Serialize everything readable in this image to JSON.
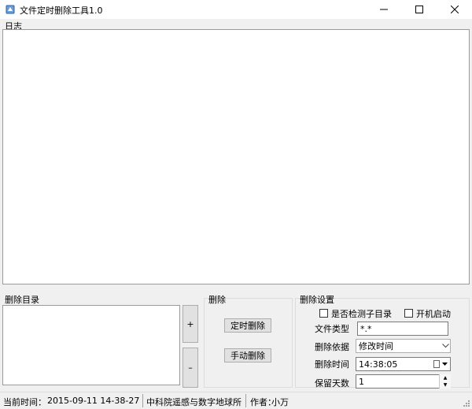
{
  "window": {
    "title": "文件定时删除工具1.0",
    "minimize_symbol": "—",
    "maximize_symbol": "☐",
    "close_symbol": "✕"
  },
  "log": {
    "label": "日志"
  },
  "directory": {
    "label": "删除目录",
    "add_label": "+",
    "remove_label": "–"
  },
  "delete": {
    "label": "删除",
    "timed_button": "定时删除",
    "manual_button": "手动删除"
  },
  "settings": {
    "label": "删除设置",
    "check_subdir_label": "是否检测子目录",
    "check_subdir_checked": false,
    "startup_label": "开机启动",
    "startup_checked": false,
    "file_type_label": "文件类型",
    "file_type_value": "*.*",
    "basis_label": "删除依据",
    "basis_value": "修改时间",
    "time_label": "删除时间",
    "time_value": "14:38:05",
    "days_label": "保留天数",
    "days_value": "1"
  },
  "status": {
    "time_label": "当前时间：",
    "time_value": "2015-09-11 14-38-27",
    "org": "中科院遥感与数字地球所",
    "author_label": "作者：",
    "author": "小万"
  },
  "icons": {
    "app": "app-icon",
    "calendar": "calendar-icon",
    "dropdown": "chevron-down-icon"
  }
}
